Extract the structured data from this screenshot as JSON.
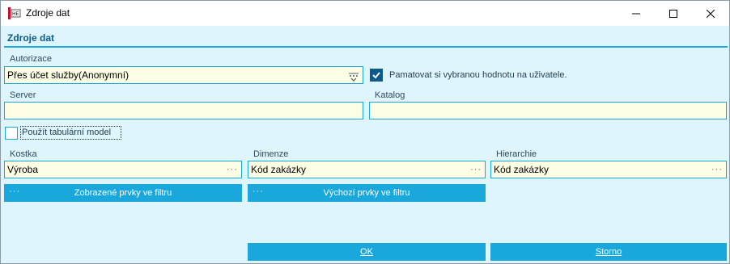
{
  "window": {
    "title": "Zdroje dat"
  },
  "section": {
    "title": "Zdroje dat"
  },
  "authorization": {
    "label": "Autorizace",
    "value": "Přes účet služby(Anonymní)",
    "remember_label": "Pamatovat si vybranou hodnotu na uživatele.",
    "remember_checked": true
  },
  "server": {
    "label": "Server",
    "value": ""
  },
  "catalog": {
    "label": "Katalog",
    "value": ""
  },
  "tabular": {
    "label": "Použít tabulární model",
    "checked": false
  },
  "cube": {
    "label": "Kostka",
    "value": "Výroba"
  },
  "dimension": {
    "label": "Dimenze",
    "value": "Kód zakázky"
  },
  "hierarchy": {
    "label": "Hierarchie",
    "value": "Kód zakázky"
  },
  "buttons": {
    "shown_items": "Zobrazené prvky ve filtru",
    "default_items": "Výchozí prvky ve filtru",
    "ok": "OK",
    "cancel": "Storno",
    "dots": "···"
  },
  "colors": {
    "accent": "#1aa7dc",
    "background": "#dff5fd",
    "field_bg": "#fdfde5",
    "header_text": "#0b5a8a"
  }
}
